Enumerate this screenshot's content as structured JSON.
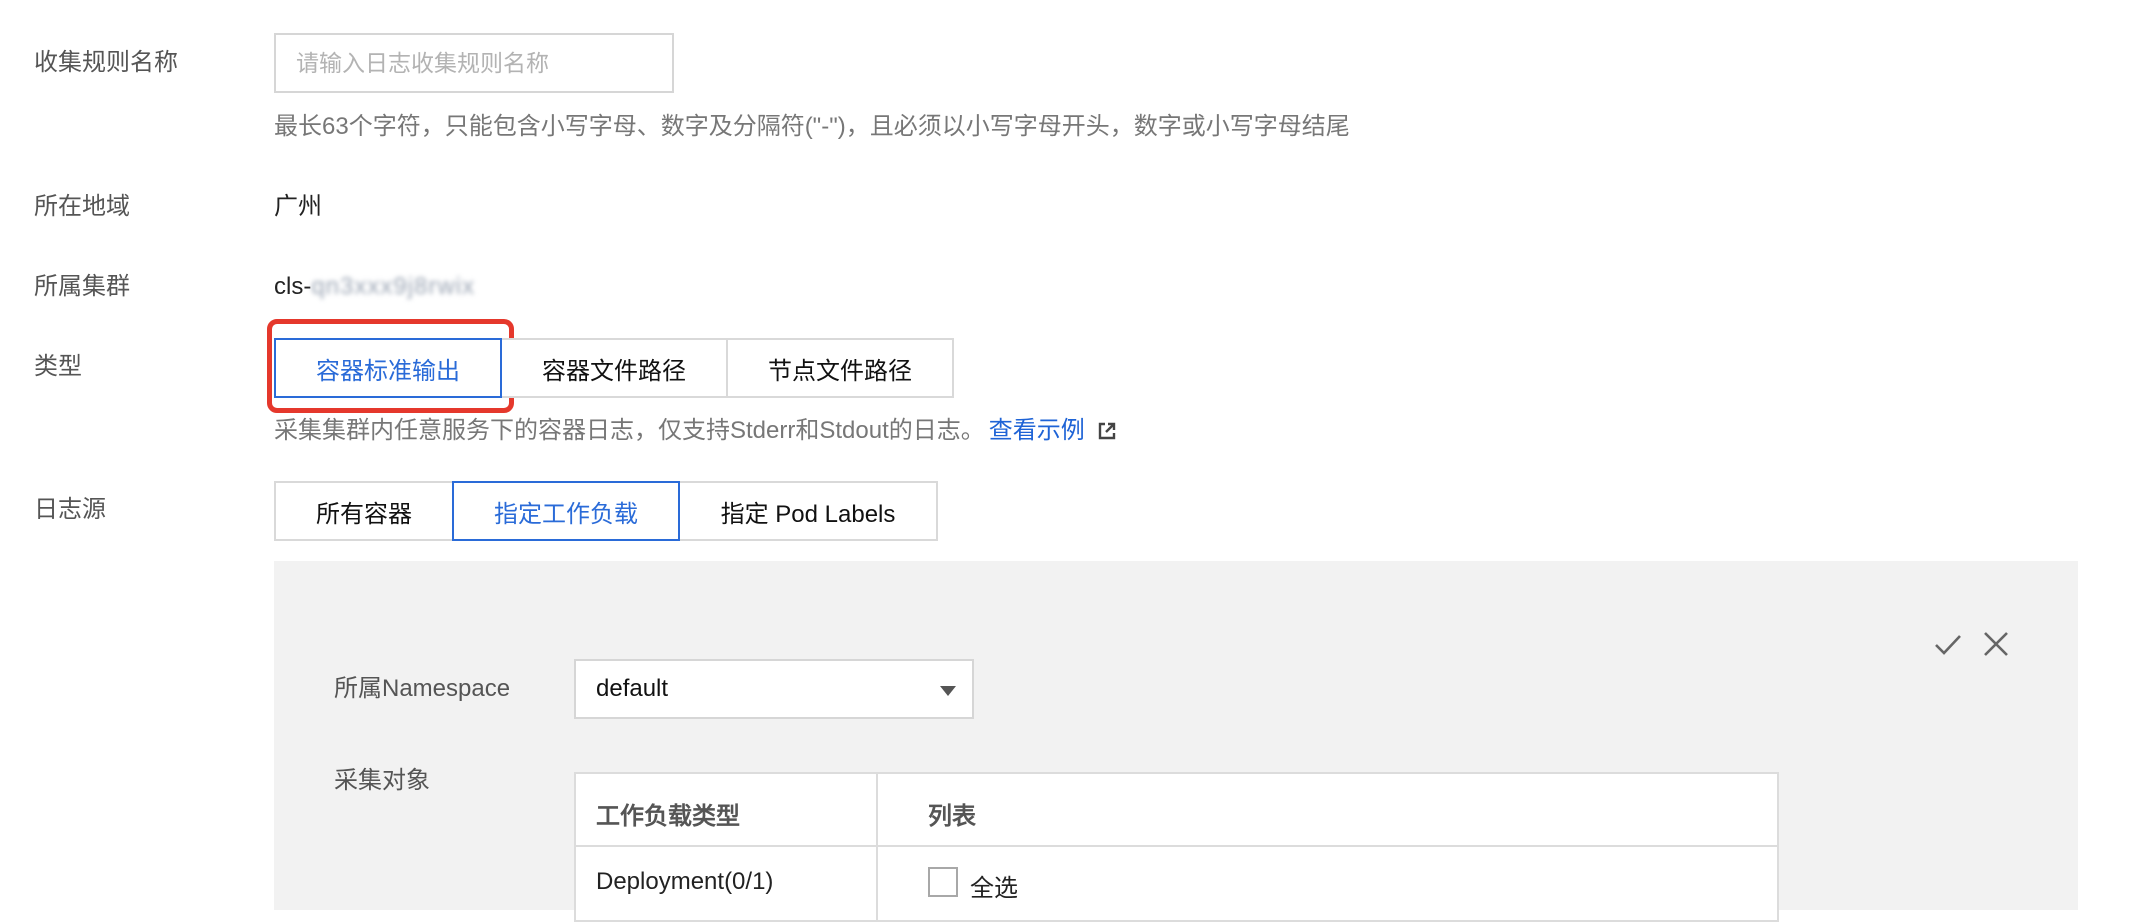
{
  "form": {
    "rule_name": {
      "label": "收集规则名称",
      "placeholder": "请输入日志收集规则名称",
      "value": "",
      "hint": "最长63个字符，只能包含小写字母、数字及分隔符(\"-\")，且必须以小写字母开头，数字或小写字母结尾"
    },
    "region": {
      "label": "所在地域",
      "value": "广州"
    },
    "cluster": {
      "label": "所属集群",
      "prefix": "cls-",
      "obscured": "qn3xxx9j8rwix"
    },
    "type": {
      "label": "类型",
      "options": [
        {
          "label": "容器标准输出",
          "selected": true
        },
        {
          "label": "容器文件路径",
          "selected": false
        },
        {
          "label": "节点文件路径",
          "selected": false
        }
      ],
      "hint": "采集集群内任意服务下的容器日志，仅支持Stderr和Stdout的日志。",
      "link": "查看示例",
      "link_icon": "external-link-icon"
    },
    "log_source": {
      "label": "日志源",
      "options": [
        {
          "label": "所有容器",
          "selected": false
        },
        {
          "label": "指定工作负载",
          "selected": true
        },
        {
          "label": "指定 Pod Labels",
          "selected": false
        }
      ]
    }
  },
  "panel": {
    "confirm_icon": "check-icon",
    "close_icon": "close-icon",
    "namespace": {
      "label": "所属Namespace",
      "value": "default"
    },
    "target": {
      "label": "采集对象",
      "columns": [
        "工作负载类型",
        "列表"
      ],
      "rows": [
        {
          "type": "Deployment(0/1)",
          "select_all": "全选",
          "checked": false
        }
      ]
    }
  },
  "colors": {
    "accent": "#2a6bd8",
    "highlight": "#e5382c",
    "panel_bg": "#f2f2f2"
  }
}
